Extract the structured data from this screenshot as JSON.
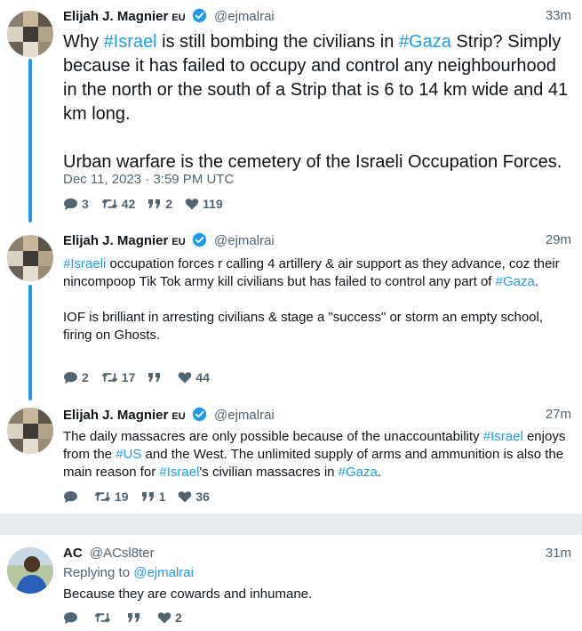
{
  "colors": {
    "link": "#1d9bf0",
    "muted": "#536471",
    "separator": "#e8ecef"
  },
  "tweets": [
    {
      "name": "Elijah J. Magnier",
      "flag": "EU",
      "handle": "@ejmalrai",
      "time": "33m",
      "paragraphs": [
        [
          {
            "t": "Why "
          },
          {
            "t": "#Israel",
            "tag": true
          },
          {
            "t": " is still bombing the civilians in "
          },
          {
            "t": "#Gaza",
            "tag": true
          },
          {
            "t": " Strip? Simply because it has failed to occupy and control any neighbourhood in the north or the south of a Strip that is 6 to 14 km wide and 41 km long."
          }
        ],
        [
          {
            "t": "Urban warfare is the cemetery of the Israeli Occupation Forces."
          }
        ]
      ],
      "date": "Dec 11, 2023 · 3:59 PM UTC",
      "stats": {
        "replies": "3",
        "retweets": "42",
        "quotes": "2",
        "likes": "119"
      }
    },
    {
      "name": "Elijah J. Magnier",
      "flag": "EU",
      "handle": "@ejmalrai",
      "time": "29m",
      "paragraphs": [
        [
          {
            "t": "#Israeli",
            "tag": true
          },
          {
            "t": " occupation forces r calling 4 artillery & air support as they advance, coz their nincompoop Tik Tok army kill civilians but has failed to control any part of "
          },
          {
            "t": "#Gaza",
            "tag": true
          },
          {
            "t": "."
          }
        ],
        [
          {
            "t": "IOF is brilliant in arresting civilians & stage a \"success\" or storm an empty school, firing on Ghosts."
          }
        ]
      ],
      "stats": {
        "replies": "2",
        "retweets": "17",
        "quotes": "",
        "likes": "44"
      }
    },
    {
      "name": "Elijah J. Magnier",
      "flag": "EU",
      "handle": "@ejmalrai",
      "time": "27m",
      "paragraphs": [
        [
          {
            "t": "The daily massacres are only possible because of the unaccountability "
          },
          {
            "t": "#Israel",
            "tag": true
          },
          {
            "t": " enjoys from the "
          },
          {
            "t": "#US",
            "tag": true
          },
          {
            "t": " and the West. The unlimited supply of arms and ammunition is also the main reason for "
          },
          {
            "t": "#Israel",
            "tag": true
          },
          {
            "t": "'s civilian massacres in "
          },
          {
            "t": "#Gaza",
            "tag": true
          },
          {
            "t": "."
          }
        ]
      ],
      "stats": {
        "replies": "",
        "retweets": "19",
        "quotes": "1",
        "likes": "36"
      }
    }
  ],
  "reply": {
    "name": "AC",
    "handle": "@ACsl8ter",
    "time": "31m",
    "replying_label": "Replying to",
    "replying_to": "@ejmalrai",
    "text": "Because they are cowards and inhumane.",
    "stats": {
      "replies": "",
      "retweets": "",
      "quotes": "",
      "likes": "2"
    }
  }
}
